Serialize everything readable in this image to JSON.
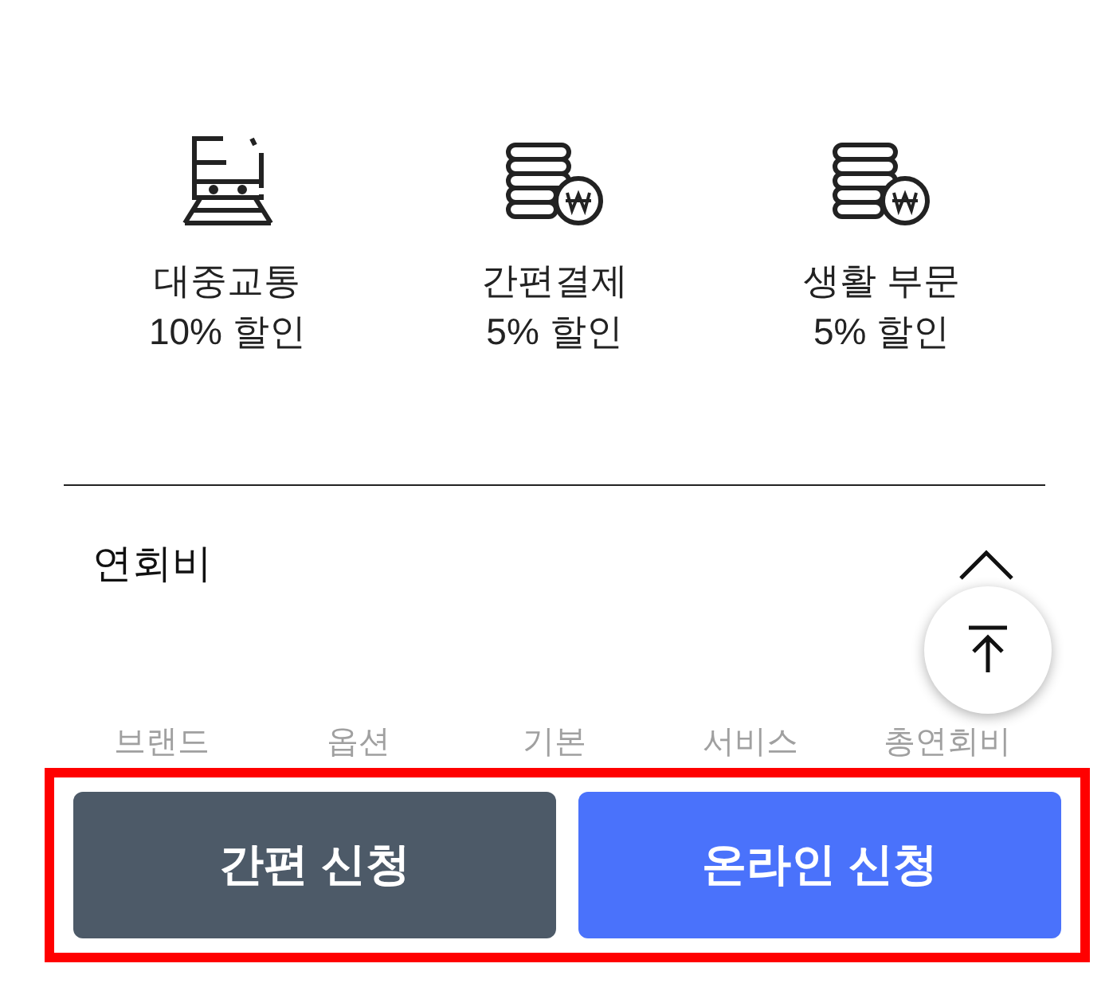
{
  "benefits": [
    {
      "kind": "train",
      "title": "대중교통",
      "discount": "10% 할인"
    },
    {
      "kind": "coins",
      "title": "간편결제",
      "discount": "5% 할인"
    },
    {
      "kind": "coins",
      "title": "생활 부문",
      "discount": "5% 할인"
    }
  ],
  "section": {
    "title": "연회비",
    "expanded": true
  },
  "table": {
    "columns": [
      "브랜드",
      "옵션",
      "기본",
      "서비스",
      "총연회비"
    ]
  },
  "buttons": [
    {
      "label": "간편 신청",
      "kind": "secondary"
    },
    {
      "label": "온라인 신청",
      "kind": "primary"
    }
  ],
  "highlight": true
}
